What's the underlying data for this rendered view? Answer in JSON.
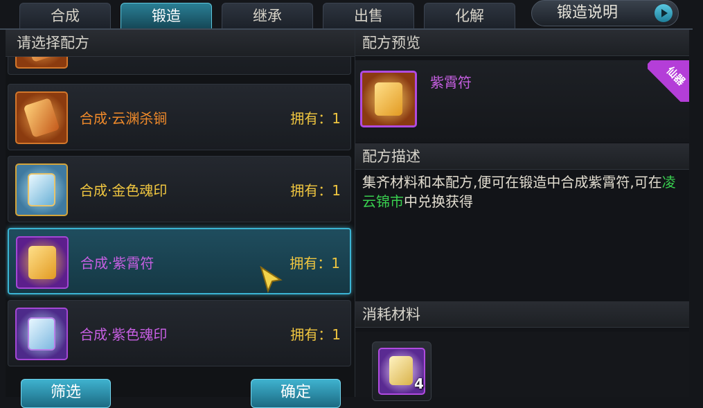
{
  "tabs": [
    {
      "label": "合成"
    },
    {
      "label": "锻造",
      "active": true
    },
    {
      "label": "继承"
    },
    {
      "label": "出售"
    },
    {
      "label": "化解"
    }
  ],
  "help_button": {
    "label": "锻造说明"
  },
  "left_panel": {
    "title": "请选择配方",
    "recipes": [
      {
        "name": "合成·云渊杀锏",
        "owned": "拥有：1",
        "name_color": "#f08a2a",
        "icon": "orange-scroll-icon"
      },
      {
        "name": "合成·金色魂印",
        "owned": "拥有：1",
        "name_color": "#f0c640",
        "icon": "gold-soul-seal-scroll-icon"
      },
      {
        "name": "合成·紫霄符",
        "owned": "拥有：1",
        "name_color": "#c65fe2",
        "icon": "purple-talisman-scroll-icon",
        "selected": true
      },
      {
        "name": "合成·紫色魂印",
        "owned": "拥有：1",
        "name_color": "#c65fe2",
        "icon": "purple-soul-seal-scroll-icon"
      }
    ],
    "filter_button": "筛选",
    "confirm_button": "确定"
  },
  "right_panel": {
    "preview_title": "配方预览",
    "preview_item_name": "紫霄符",
    "rarity_badge": "仙器",
    "description_title": "配方描述",
    "description_before": "集齐材料和本配方,便可在锻造中合成紫霄符,可在",
    "description_highlight": "凌云锦市",
    "description_after": "中兑换获得",
    "materials_title": "消耗材料",
    "materials": [
      {
        "icon": "purple-scroll-material-icon",
        "count": "4"
      }
    ]
  },
  "colors": {
    "accent": "#3bb4d4",
    "purple_quality": "#c65fe2",
    "orange_quality": "#f08a2a",
    "gold": "#f0c640",
    "highlight_green": "#39d04f"
  }
}
